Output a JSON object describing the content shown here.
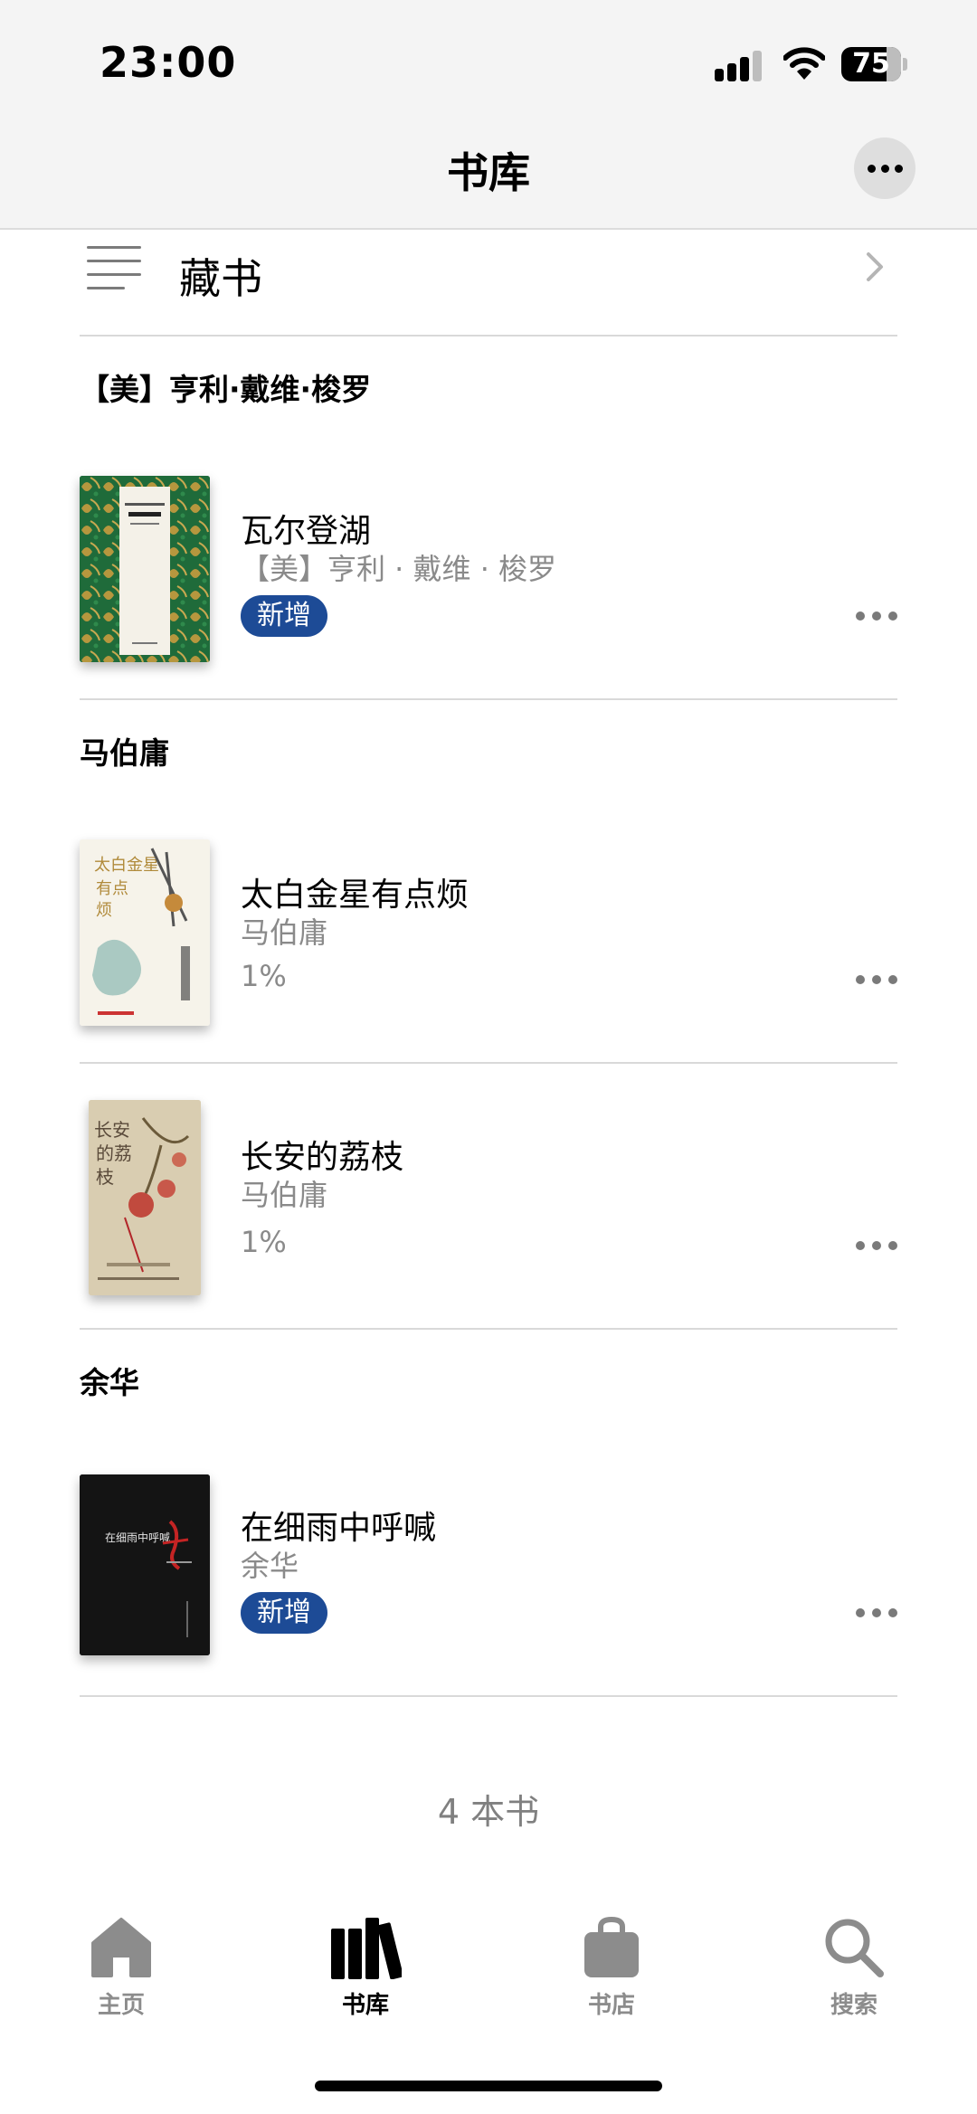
{
  "status_bar": {
    "time": "23:00",
    "battery_level": "75",
    "signal_icon": "signal-icon",
    "wifi_icon": "wifi-icon"
  },
  "header": {
    "title": "书库",
    "more_icon": "more-horizontal-icon"
  },
  "collection": {
    "label": "藏书",
    "icon": "list-icon",
    "chevron_icon": "chevron-right-icon"
  },
  "groups": [
    {
      "author": "【美】亨利·戴维·梭罗",
      "books": [
        {
          "title": "瓦尔登湖",
          "author": "【美】亨利 · 戴维 · 梭罗",
          "badge": "新增"
        }
      ]
    },
    {
      "author": "马伯庸",
      "books": [
        {
          "title": "太白金星有点烦",
          "author": "马伯庸",
          "progress": "1%"
        },
        {
          "title": "长安的荔枝",
          "author": "马伯庸",
          "progress": "1%"
        }
      ]
    },
    {
      "author": "余华",
      "books": [
        {
          "title": "在细雨中呼喊",
          "author": "余华",
          "badge": "新增"
        }
      ]
    }
  ],
  "book_count": "4 本书",
  "tabs": [
    {
      "label": "主页",
      "icon": "home-icon",
      "active": false
    },
    {
      "label": "书库",
      "icon": "library-icon",
      "active": true
    },
    {
      "label": "书店",
      "icon": "bookstore-bag-icon",
      "active": false
    },
    {
      "label": "搜索",
      "icon": "search-icon",
      "active": false
    }
  ],
  "colors": {
    "badge": "#1d4b96",
    "secondary_text": "#8a8a8a",
    "divider": "#d9d9d9"
  }
}
